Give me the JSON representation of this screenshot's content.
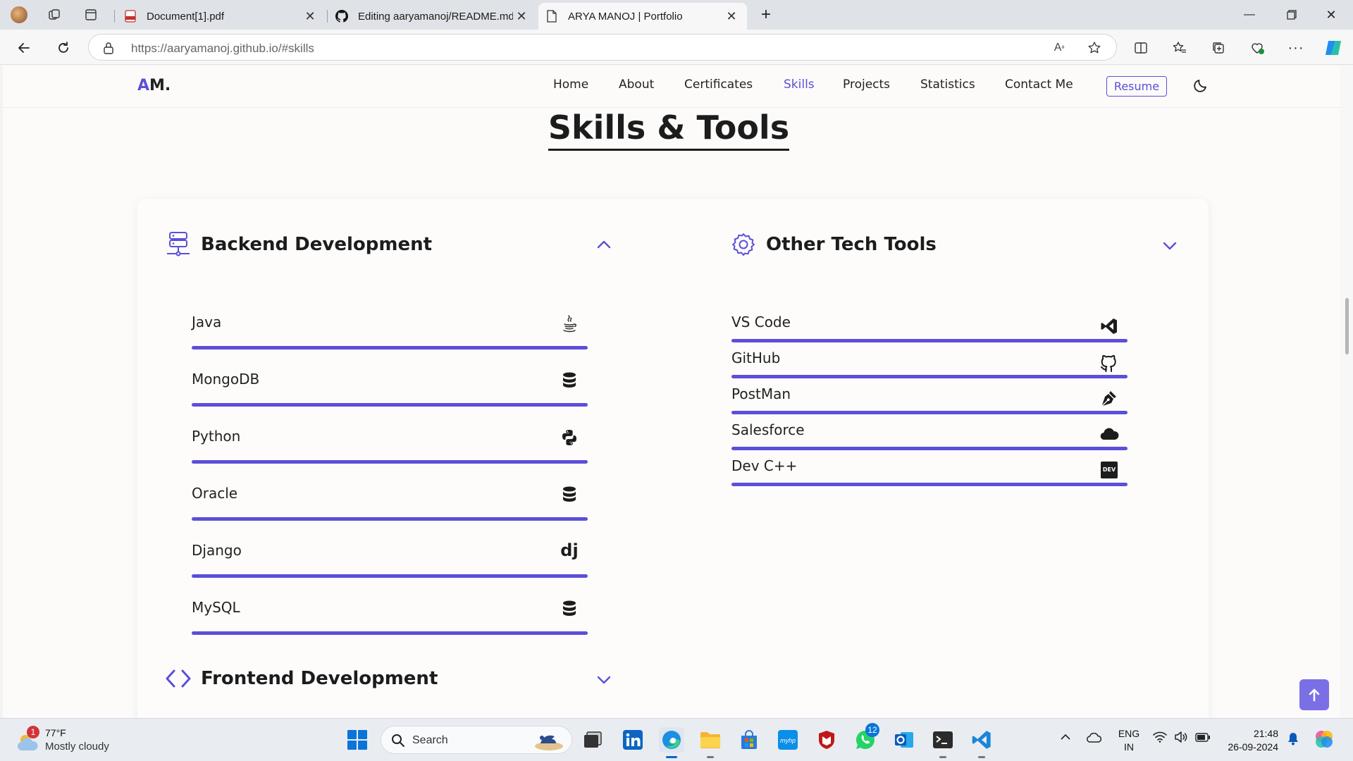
{
  "browser": {
    "tabs": [
      {
        "title": "Document[1].pdf",
        "icon": "pdf-icon"
      },
      {
        "title": "Editing aaryamanoj/README.md",
        "icon": "github-icon"
      },
      {
        "title": "ARYA MANOJ | Portfolio",
        "icon": "page-icon",
        "active": true
      }
    ],
    "url_host": "https://aaryamanoj.github.io",
    "url_path": "/#skills"
  },
  "nav": {
    "logo_accent": "A",
    "logo_rest": "M.",
    "links": [
      "Home",
      "About",
      "Certificates",
      "Skills",
      "Projects",
      "Statistics",
      "Contact Me"
    ],
    "active_link": "Skills",
    "resume": "Resume"
  },
  "section": {
    "title": "Skills & Tools"
  },
  "groups": {
    "backend": {
      "title": "Backend Development",
      "expanded": true,
      "icon": "server-icon",
      "skills": [
        {
          "name": "Java",
          "icon": "java-icon",
          "level": 1.0
        },
        {
          "name": "MongoDB",
          "icon": "database-icon",
          "level": 1.0
        },
        {
          "name": "Python",
          "icon": "python-icon",
          "level": 1.0
        },
        {
          "name": "Oracle",
          "icon": "database-icon",
          "level": 1.0
        },
        {
          "name": "Django",
          "icon": "django-icon",
          "level": 1.0
        },
        {
          "name": "MySQL",
          "icon": "database-icon",
          "level": 1.0
        }
      ]
    },
    "tools": {
      "title": "Other Tech Tools",
      "expanded": false,
      "icon": "gear-icon",
      "skills": [
        {
          "name": "VS Code",
          "icon": "vscode-icon",
          "level": 1.0
        },
        {
          "name": "GitHub",
          "icon": "github-icon",
          "level": 1.0
        },
        {
          "name": "PostMan",
          "icon": "pen-nib-icon",
          "level": 1.0
        },
        {
          "name": "Salesforce",
          "icon": "cloud-icon",
          "level": 1.0
        },
        {
          "name": "Dev C++",
          "icon": "dev-icon",
          "level": 1.0
        }
      ]
    },
    "frontend": {
      "title": "Frontend Development",
      "expanded": false,
      "icon": "code-icon"
    }
  },
  "dev_badge": "DEV",
  "django_glyph": "dj",
  "colors": {
    "accent": "#5b4fd9",
    "scroll_button": "#7b6fe6"
  },
  "taskbar": {
    "weather_temp": "77°F",
    "weather_desc": "Mostly cloudy",
    "weather_badge": "1",
    "search_label": "Search",
    "whatsapp_badge": "12",
    "lang_line1": "ENG",
    "lang_line2": "IN",
    "time": "21:48",
    "date": "26-09-2024"
  }
}
